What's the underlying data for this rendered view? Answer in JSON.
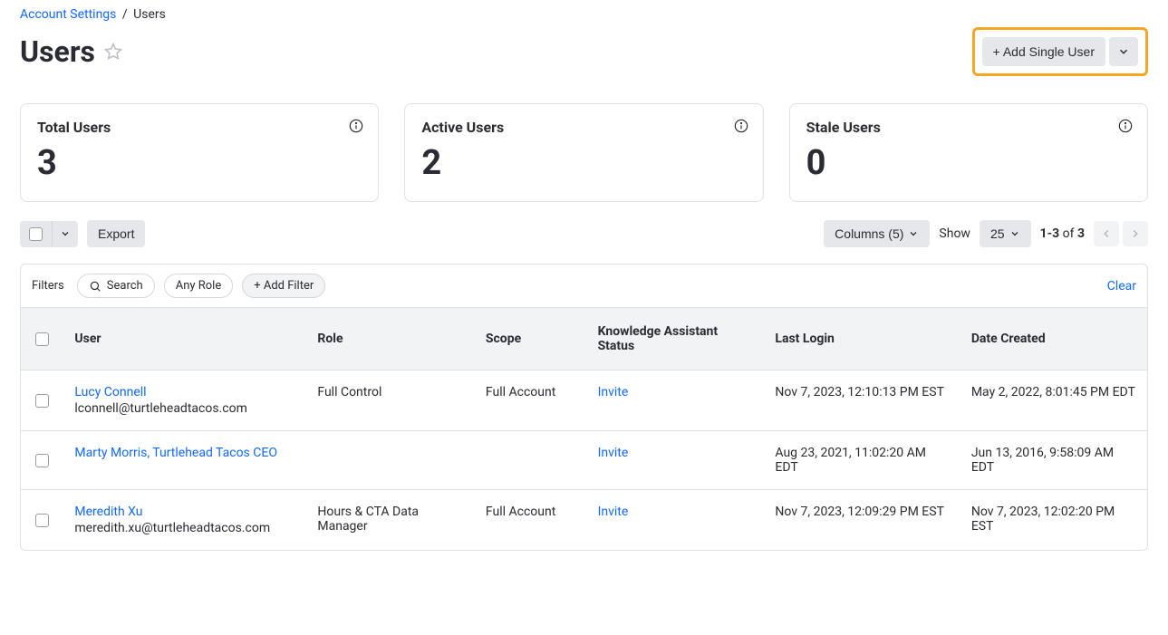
{
  "breadcrumb": {
    "parent": "Account Settings",
    "current": "Users"
  },
  "page": {
    "title": "Users",
    "add_user_label": "+ Add Single User"
  },
  "stats": [
    {
      "label": "Total Users",
      "value": "3"
    },
    {
      "label": "Active Users",
      "value": "2"
    },
    {
      "label": "Stale Users",
      "value": "0"
    }
  ],
  "toolbar": {
    "export_label": "Export",
    "columns_label": "Columns (5)",
    "show_label": "Show",
    "page_size": "25",
    "pagination_range": "1-3",
    "pagination_of": "of",
    "pagination_total": "3"
  },
  "filter_bar": {
    "filters_label": "Filters",
    "search_label": "Search",
    "any_role_label": "Any Role",
    "add_filter_label": "+ Add Filter",
    "clear_label": "Clear"
  },
  "columns": {
    "user": "User",
    "role": "Role",
    "scope": "Scope",
    "ka_status": "Knowledge Assistant Status",
    "last_login": "Last Login",
    "date_created": "Date Created"
  },
  "rows": [
    {
      "name": "Lucy Connell",
      "sub": "lconnell@turtleheadtacos.com",
      "role": "Full Control",
      "scope": "Full Account",
      "ka_status": "Invite",
      "last_login": "Nov 7, 2023, 12:10:13 PM EST",
      "date_created": "May 2, 2022, 8:01:45 PM EDT"
    },
    {
      "name": "Marty Morris, Turtlehead Tacos CEO",
      "sub": "",
      "role": "",
      "scope": "",
      "ka_status": "Invite",
      "last_login": "Aug 23, 2021, 11:02:20 AM EDT",
      "date_created": "Jun 13, 2016, 9:58:09 AM EDT"
    },
    {
      "name": "Meredith Xu",
      "sub": "meredith.xu@turtleheadtacos.com",
      "role": "Hours & CTA Data Manager",
      "scope": "Full Account",
      "ka_status": "Invite",
      "last_login": "Nov 7, 2023, 12:09:29 PM EST",
      "date_created": "Nov 7, 2023, 12:02:20 PM EST"
    }
  ]
}
